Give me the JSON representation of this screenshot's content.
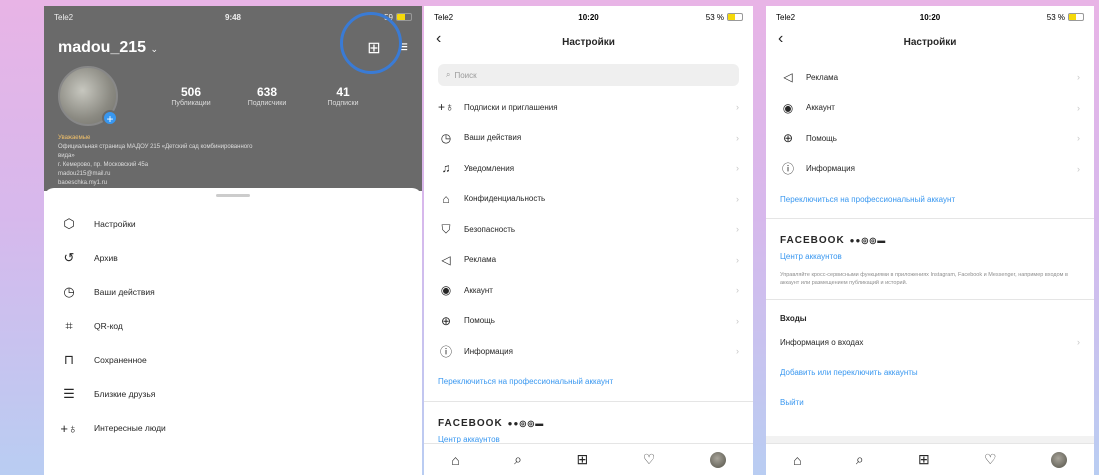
{
  "phone1": {
    "status": {
      "carrier": "Tele2",
      "time": "9:48",
      "battery": "59"
    },
    "username": "madou_215",
    "stats": [
      {
        "num": "506",
        "label": "Публикации"
      },
      {
        "num": "638",
        "label": "Подписчики"
      },
      {
        "num": "41",
        "label": "Подписки"
      }
    ],
    "bio": {
      "title": "Уважаемые",
      "lines": [
        "Официальная страница МАДОУ 215 «Детский сад комбинированного",
        "вида»",
        "г. Кемерово, пр. Московский 45а",
        "madou215@mail.ru",
        "baoeschka.my1.ru"
      ]
    },
    "menu": [
      {
        "label": "Настройки",
        "icon": "settings-icon"
      },
      {
        "label": "Архив",
        "icon": "archive-icon"
      },
      {
        "label": "Ваши действия",
        "icon": "activity-icon"
      },
      {
        "label": "QR-код",
        "icon": "qr-icon"
      },
      {
        "label": "Сохраненное",
        "icon": "bookmark-icon"
      },
      {
        "label": "Близкие друзья",
        "icon": "list-icon"
      },
      {
        "label": "Интересные люди",
        "icon": "add-person-icon"
      }
    ]
  },
  "phone2": {
    "status": {
      "carrier": "Tele2",
      "time": "10:20",
      "battery": "53 %"
    },
    "title": "Настройки",
    "search_placeholder": "Поиск",
    "items": [
      {
        "label": "Подписки и приглашения",
        "icon": "add-person-icon"
      },
      {
        "label": "Ваши действия",
        "icon": "activity-icon"
      },
      {
        "label": "Уведомления",
        "icon": "bell-icon"
      },
      {
        "label": "Конфиденциальность",
        "icon": "lock-icon"
      },
      {
        "label": "Безопасность",
        "icon": "shield-icon"
      },
      {
        "label": "Реклама",
        "icon": "megaphone-icon"
      },
      {
        "label": "Аккаунт",
        "icon": "account-icon"
      },
      {
        "label": "Помощь",
        "icon": "help-icon"
      },
      {
        "label": "Информация",
        "icon": "info-icon"
      }
    ],
    "pro_link": "Переключиться на профессиональный аккаунт",
    "fb_title": "FACEBOOK",
    "fb_link": "Центр аккаунтов"
  },
  "phone3": {
    "status": {
      "carrier": "Tele2",
      "time": "10:20",
      "battery": "53 %"
    },
    "title": "Настройки",
    "items": [
      {
        "label": "Реклама",
        "icon": "megaphone-icon"
      },
      {
        "label": "Аккаунт",
        "icon": "account-icon"
      },
      {
        "label": "Помощь",
        "icon": "help-icon"
      },
      {
        "label": "Информация",
        "icon": "info-icon"
      }
    ],
    "pro_link": "Переключиться на профессиональный аккаунт",
    "fb_title": "FACEBOOK",
    "fb_link": "Центр аккаунтов",
    "fb_desc": "Управляйте кросс-сервисными функциями в приложениях Instagram, Facebook и Messenger, например входом в аккаунт или размещением публикаций и историй.",
    "logins_head": "Входы",
    "logins_info": "Информация о входах",
    "add_accounts": "Добавить или переключить аккаунты",
    "logout": "Выйти"
  },
  "colors": {
    "link": "#3897f0",
    "highlight": "#3a7bd5"
  },
  "progress": {
    "battery_phone1": 0.59,
    "battery_phone2": 0.53
  }
}
